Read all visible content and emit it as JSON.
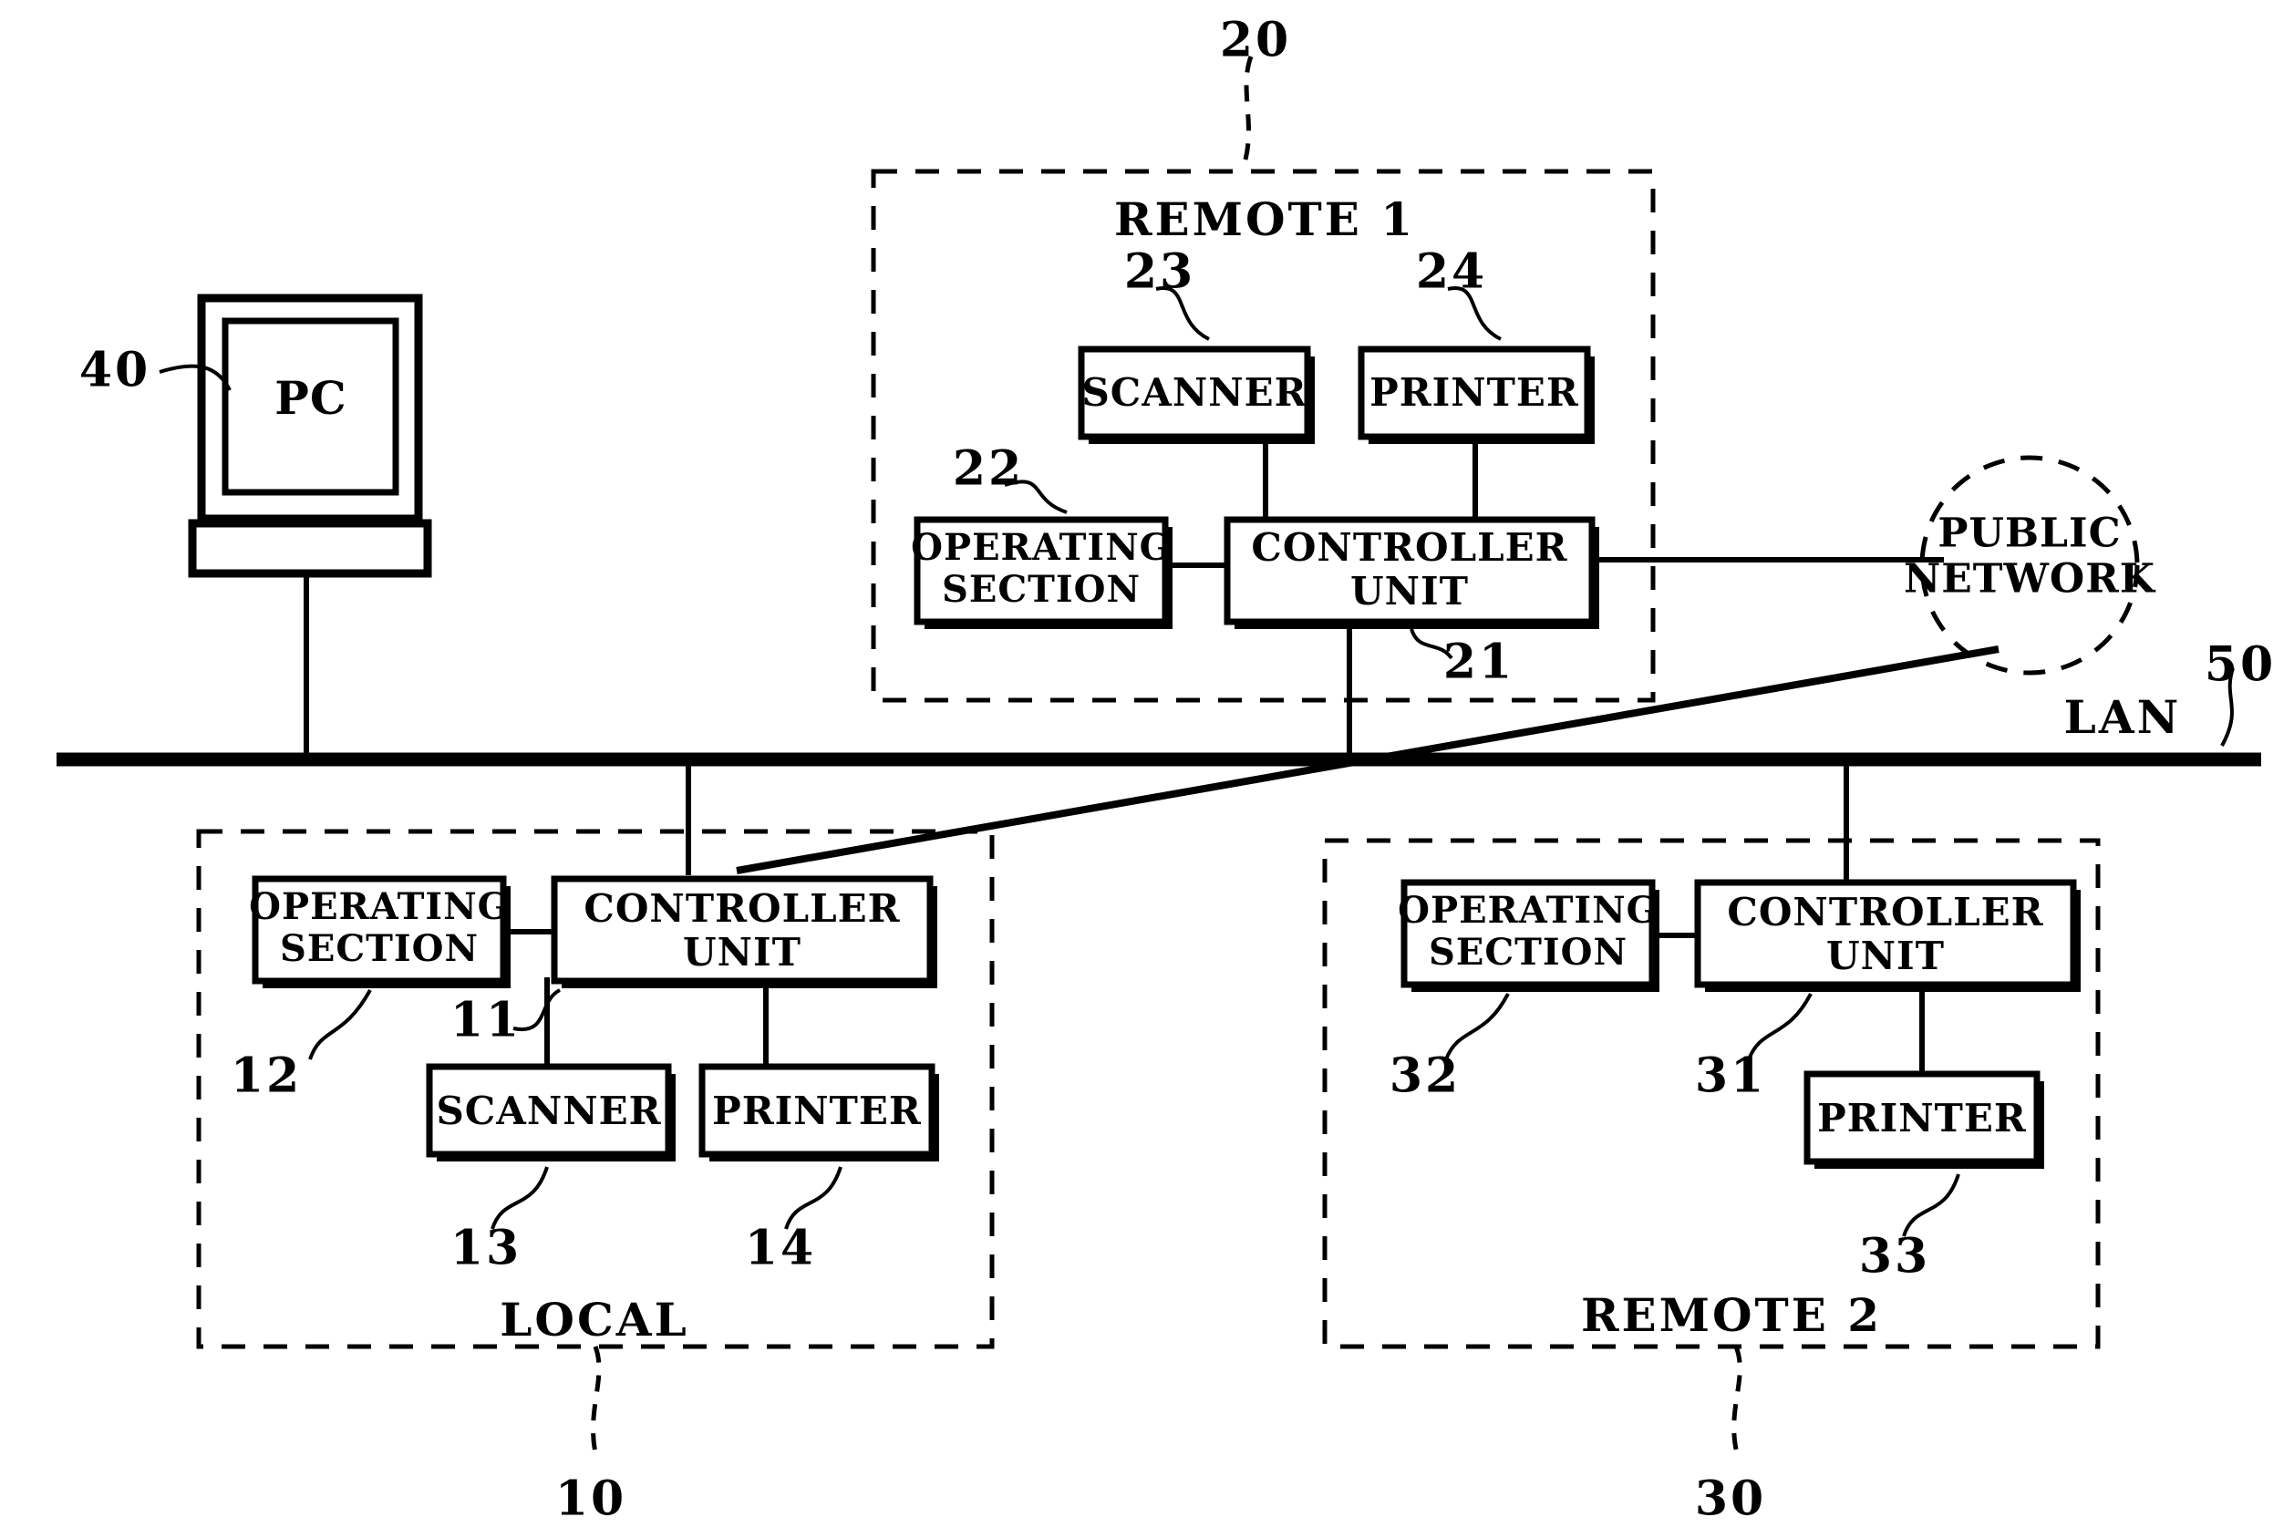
{
  "figure": {
    "title": "Network system block diagram",
    "background_color": "#ffffff",
    "line_color": "#000000"
  },
  "workstation": {
    "label": "PC",
    "ref": "40"
  },
  "lan": {
    "label": "LAN",
    "ref": "50"
  },
  "public_network": {
    "line1": "PUBLIC",
    "line2": "NETWORK"
  },
  "groups": {
    "local": {
      "label": "LOCAL",
      "ref": "10",
      "nodes": {
        "controller": {
          "line1": "CONTROLLER",
          "line2": "UNIT",
          "ref": "11"
        },
        "operating": {
          "line1": "OPERATING",
          "line2": "SECTION",
          "ref": "12"
        },
        "scanner": {
          "label": "SCANNER",
          "ref": "13"
        },
        "printer": {
          "label": "PRINTER",
          "ref": "14"
        }
      }
    },
    "remote1": {
      "label": "REMOTE 1",
      "ref": "20",
      "nodes": {
        "controller": {
          "line1": "CONTROLLER",
          "line2": "UNIT",
          "ref": "21"
        },
        "operating": {
          "line1": "OPERATING",
          "line2": "SECTION",
          "ref": "22"
        },
        "scanner": {
          "label": "SCANNER",
          "ref": "23"
        },
        "printer": {
          "label": "PRINTER",
          "ref": "24"
        }
      }
    },
    "remote2": {
      "label": "REMOTE 2",
      "ref": "30",
      "nodes": {
        "controller": {
          "line1": "CONTROLLER",
          "line2": "UNIT",
          "ref": "31"
        },
        "operating": {
          "line1": "OPERATING",
          "line2": "SECTION",
          "ref": "32"
        },
        "printer": {
          "label": "PRINTER",
          "ref": "33"
        }
      }
    }
  }
}
